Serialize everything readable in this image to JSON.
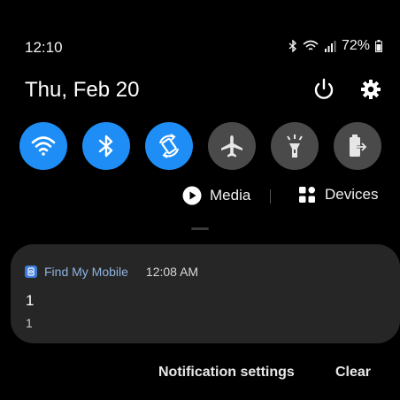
{
  "status_bar": {
    "time": "12:10",
    "battery": "72%",
    "icons": [
      "bluetooth-icon",
      "wifi-icon",
      "signal-icon",
      "battery-icon"
    ]
  },
  "header": {
    "date": "Thu, Feb 20",
    "power_icon": "power-icon",
    "settings_icon": "gear-icon"
  },
  "quick_settings": {
    "tiles": [
      {
        "name": "wifi",
        "icon": "wifi-icon",
        "state": "on"
      },
      {
        "name": "bluetooth",
        "icon": "bluetooth-icon",
        "state": "on"
      },
      {
        "name": "auto-rotate",
        "icon": "auto-rotate-icon",
        "state": "on"
      },
      {
        "name": "airplane-mode",
        "icon": "airplane-icon",
        "state": "off"
      },
      {
        "name": "flashlight",
        "icon": "flashlight-icon",
        "state": "off"
      },
      {
        "name": "power-saving",
        "icon": "battery-saver-icon",
        "state": "off"
      }
    ],
    "colors": {
      "on": "#1e8ef6",
      "off": "#4a4a4a"
    }
  },
  "media_devices": {
    "media_label": "Media",
    "devices_label": "Devices"
  },
  "notification": {
    "app_name": "Find My Mobile",
    "time": "12:08 AM",
    "title": "1",
    "body": "1"
  },
  "footer": {
    "settings_label": "Notification settings",
    "clear_label": "Clear"
  }
}
